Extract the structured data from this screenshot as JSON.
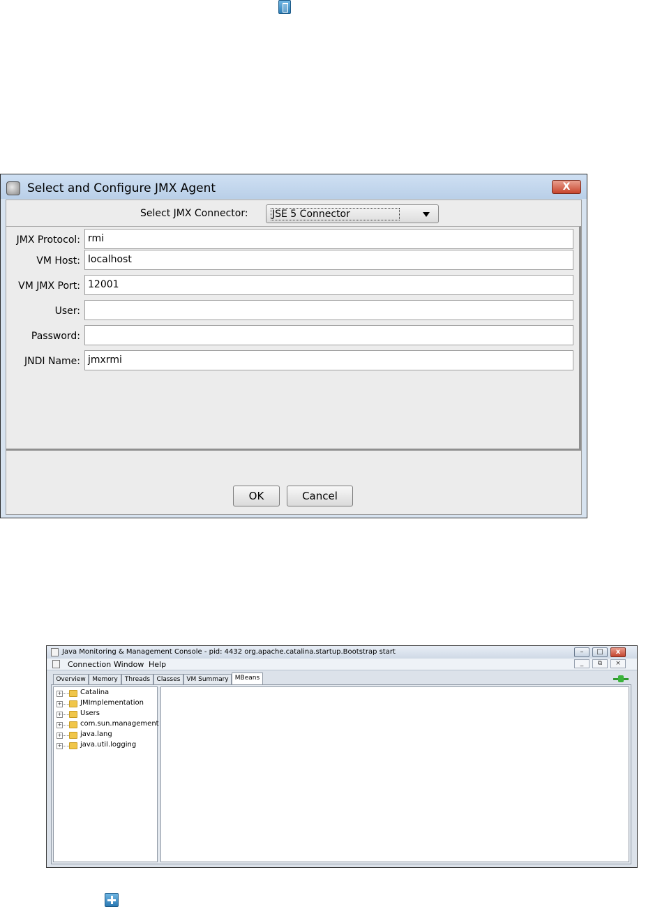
{
  "dialog": {
    "title": "Select and Configure JMX Agent",
    "close_label": "X",
    "connector_label": "Select JMX Connector:",
    "connector_value": "JSE 5 Connector",
    "fields": [
      {
        "label": "JMX Protocol:",
        "value": "rmi"
      },
      {
        "label": "VM Host:",
        "value": "localhost"
      },
      {
        "label": "VM JMX Port:",
        "value": "12001"
      },
      {
        "label": "User:",
        "value": ""
      },
      {
        "label": "Password:",
        "value": ""
      },
      {
        "label": "JNDI Name:",
        "value": "jmxrmi"
      }
    ],
    "ok_label": "OK",
    "cancel_label": "Cancel"
  },
  "jconsole": {
    "title": "Java Monitoring & Management Console - pid: 4432 org.apache.catalina.startup.Bootstrap start",
    "window_buttons": {
      "minimize": "–",
      "maximize": "□",
      "close": "x"
    },
    "mdi_buttons": {
      "minimize": "_",
      "restore": "⧉",
      "close": "×"
    },
    "menus": [
      "Connection",
      "Window",
      "Help"
    ],
    "tabs": [
      "Overview",
      "Memory",
      "Threads",
      "Classes",
      "VM Summary",
      "MBeans"
    ],
    "active_tab": "MBeans",
    "tree": [
      "Catalina",
      "JMImplementation",
      "Users",
      "com.sun.management",
      "java.lang",
      "java.util.logging"
    ]
  },
  "colors": {
    "dialog_title_bar": "#b9cfe8",
    "close_button": "#c8452d",
    "connect_icon": "#2f9a2f",
    "folder": "#f0c64a"
  }
}
